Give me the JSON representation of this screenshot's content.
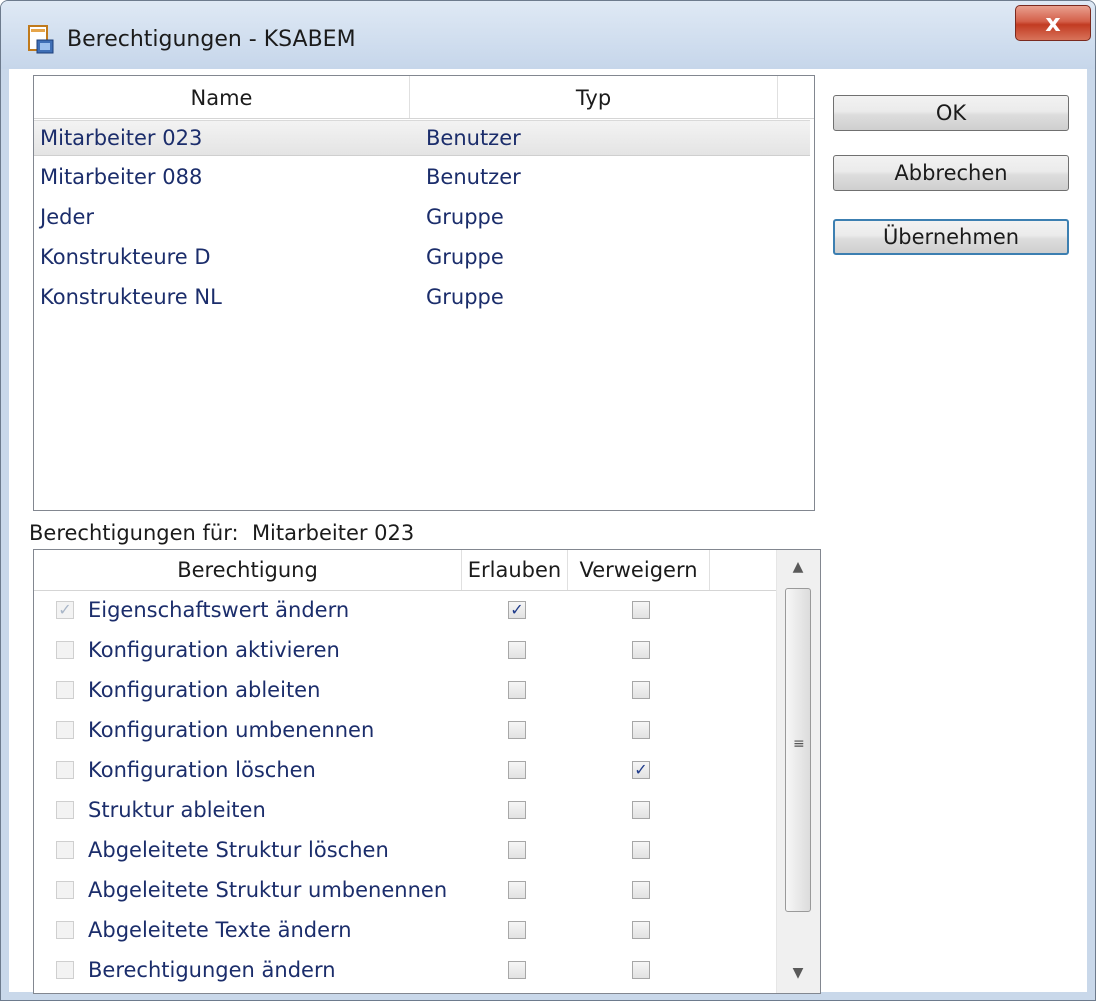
{
  "window": {
    "title": "Berechtigungen - KSABEM",
    "close_label": "x"
  },
  "users_list": {
    "columns": {
      "name": "Name",
      "typ": "Typ"
    },
    "rows": [
      {
        "name": "Mitarbeiter 023",
        "typ": "Benutzer",
        "selected": true
      },
      {
        "name": "Mitarbeiter 088",
        "typ": "Benutzer",
        "selected": false
      },
      {
        "name": "Jeder",
        "typ": "Gruppe",
        "selected": false
      },
      {
        "name": "Konstrukteure D",
        "typ": "Gruppe",
        "selected": false
      },
      {
        "name": "Konstrukteure NL",
        "typ": "Gruppe",
        "selected": false
      }
    ]
  },
  "permissions": {
    "label_prefix": "Berechtigungen für:",
    "label_user": "Mitarbeiter 023",
    "columns": {
      "perm": "Berechtigung",
      "allow": "Erlauben",
      "deny": "Verweigern"
    },
    "rows": [
      {
        "label": "Eigenschaftswert ändern",
        "enabled": true,
        "allow": true,
        "deny": false
      },
      {
        "label": "Konfiguration aktivieren",
        "enabled": false,
        "allow": false,
        "deny": false
      },
      {
        "label": "Konfiguration ableiten",
        "enabled": false,
        "allow": false,
        "deny": false
      },
      {
        "label": "Konfiguration umbenennen",
        "enabled": false,
        "allow": false,
        "deny": false
      },
      {
        "label": "Konfiguration löschen",
        "enabled": false,
        "allow": false,
        "deny": true
      },
      {
        "label": "Struktur ableiten",
        "enabled": false,
        "allow": false,
        "deny": false
      },
      {
        "label": "Abgeleitete Struktur löschen",
        "enabled": false,
        "allow": false,
        "deny": false
      },
      {
        "label": "Abgeleitete Struktur umbenennen",
        "enabled": false,
        "allow": false,
        "deny": false
      },
      {
        "label": "Abgeleitete Texte ändern",
        "enabled": false,
        "allow": false,
        "deny": false
      },
      {
        "label": "Berechtigungen ändern",
        "enabled": false,
        "allow": false,
        "deny": false
      }
    ]
  },
  "buttons": {
    "ok": "OK",
    "cancel": "Abbrechen",
    "apply": "Übernehmen"
  },
  "icons": {
    "window": "document-lock-icon",
    "close": "close-icon",
    "scroll_up": "chevron-up-icon",
    "scroll_down": "chevron-down-icon"
  },
  "colors": {
    "titlebar": "#c6d6ea",
    "close_button": "#c23b22",
    "list_text": "#1b2d6b",
    "focus_border": "#3c7fb1"
  }
}
